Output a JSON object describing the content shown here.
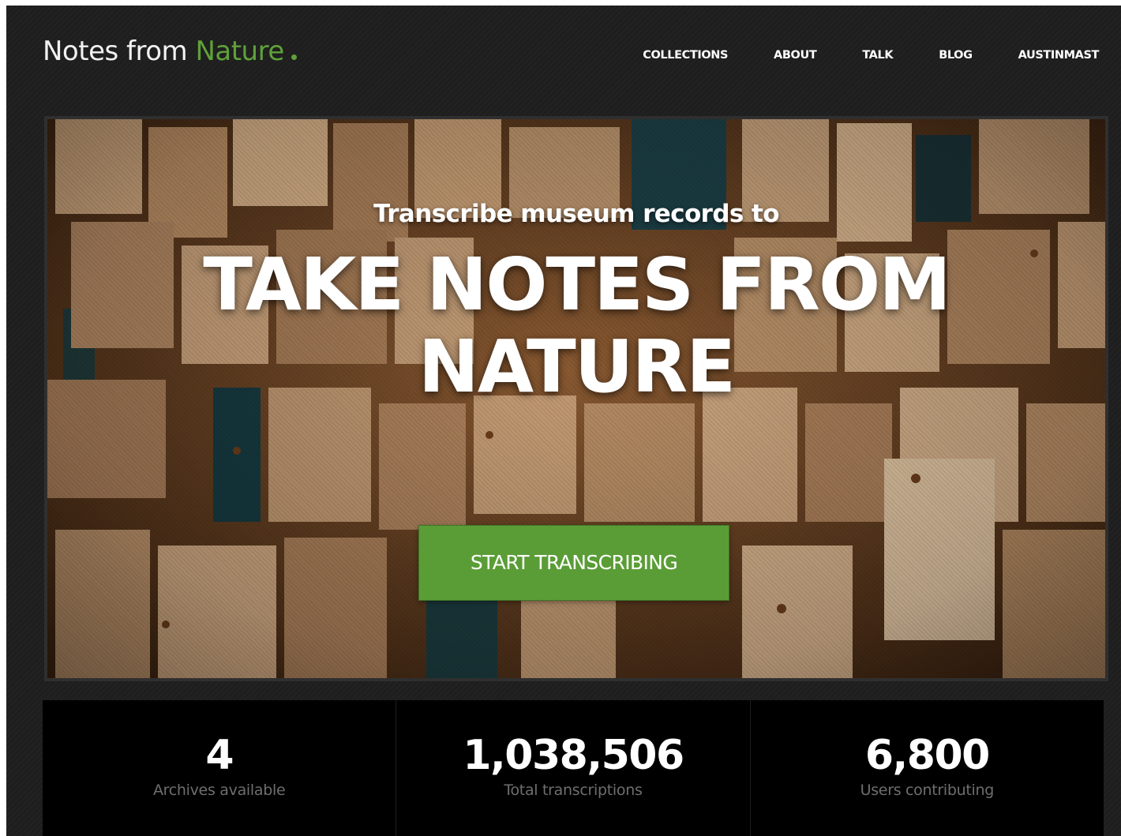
{
  "header": {
    "brand_part1": "Notes from ",
    "brand_part2": "Nature",
    "nav": [
      "COLLECTIONS",
      "ABOUT",
      "TALK",
      "BLOG",
      "AUSTINMAST"
    ]
  },
  "hero": {
    "subtitle": "Transcribe museum records to",
    "title_line1": "TAKE NOTES FROM",
    "title_line2": "NATURE",
    "cta_label": "START TRANSCRIBING"
  },
  "stats": [
    {
      "value": "4",
      "label": "Archives available"
    },
    {
      "value": "1,038,506",
      "label": "Total transcriptions"
    },
    {
      "value": "6,800",
      "label": "Users contributing"
    }
  ],
  "colors": {
    "background": "#1e1e1e",
    "accent_green": "#5fa13a",
    "cta_green": "#5a9d36",
    "stats_background": "#000000",
    "stat_label": "#6e6e6e"
  }
}
